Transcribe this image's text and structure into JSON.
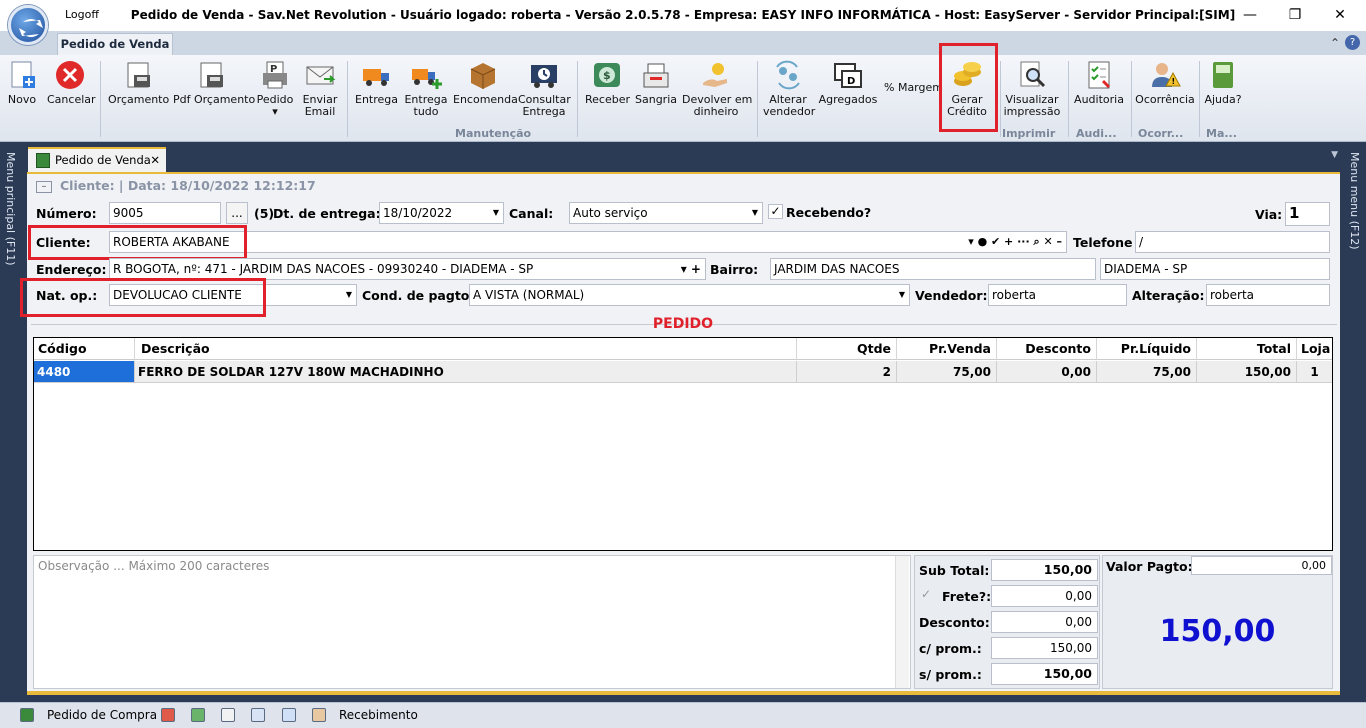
{
  "window": {
    "title": "Pedido de Venda - Sav.Net Revolution - Usuário logado: roberta - Versão 2.0.5.78 - Empresa: EASY INFO INFORMÁTICA - Host: EasyServer - Servidor Principal:[SIM]",
    "logoff": "Logoff",
    "minimize": "—",
    "restore": "❐",
    "close": "✕"
  },
  "ribbon": {
    "tab": "Pedido de Venda",
    "buttons": {
      "novo": "Novo",
      "cancelar": "Cancelar",
      "orcamento": "Orçamento",
      "pdf_orcamento": "Pdf Orçamento",
      "pedido": "Pedido",
      "enviar_email_1": "Enviar",
      "enviar_email_2": "Email",
      "entrega": "Entrega",
      "entrega_tudo_1": "Entrega",
      "entrega_tudo_2": "tudo",
      "encomenda": "Encomenda",
      "consultar_1": "Consultar",
      "consultar_2": "Entrega",
      "receber": "Receber",
      "sangria": "Sangria",
      "devolver_1": "Devolver em",
      "devolver_2": "dinheiro",
      "alterar_1": "Alterar",
      "alterar_2": "vendedor",
      "agregados": "Agregados",
      "margem": "% Margem",
      "gerar_1": "Gerar",
      "gerar_2": "Crédito",
      "visualizar_1": "Visualizar",
      "visualizar_2": "impressão",
      "auditoria": "Auditoria",
      "ocorrencia": "Ocorrência",
      "ajuda": "Ajuda?"
    },
    "groups": {
      "manutencao": "Manutenção",
      "imprimir": "Imprimir",
      "audi": "Audi...",
      "ocorr": "Ocorr...",
      "ma": "Ma..."
    }
  },
  "side": {
    "left": "Menu principal (F11)",
    "right": "Menu menu (F12)"
  },
  "doc_tab": {
    "label": "Pedido de Venda",
    "close": "✕"
  },
  "form": {
    "header_group": "Cliente:  | Data: 18/10/2022 12:12:17",
    "numero_label": "Número:",
    "numero_value": "9005",
    "numero_btn": "...",
    "num5": "(5)",
    "dt_entrega_label": "Dt. de entrega:",
    "dt_entrega_value": "18/10/2022",
    "canal_label": "Canal:",
    "canal_value": "Auto serviço",
    "recebendo_label": "Recebendo?",
    "via_label": "Via:",
    "via_value": "1",
    "cliente_label": "Cliente:",
    "cliente_value": "ROBERTA AKABANE",
    "cliente_tools": "▾ ● ✔ + ··· ⌕ ✕ –",
    "telefone_label": "Telefone",
    "telefone_value": " /",
    "endereco_label": "Endereço:",
    "endereco_value": "R BOGOTA, nº: 471 - JARDIM DAS NACOES - 09930240 - DIADEMA - SP",
    "endereco_tools": "▾ +",
    "bairro_label": "Bairro:",
    "bairro_value": "JARDIM DAS NACOES",
    "cidade_value": "DIADEMA - SP",
    "natop_label": "Nat. op.:",
    "natop_value": "DEVOLUCAO CLIENTE",
    "cond_label": "Cond. de pagto:",
    "cond_value": "A VISTA (NORMAL)",
    "vendedor_label": "Vendedor:",
    "vendedor_value": "roberta",
    "alteracao_label": "Alteração:",
    "alteracao_value": "roberta"
  },
  "pedido_title": "PEDIDO",
  "grid": {
    "headers": {
      "codigo": "Código",
      "descricao": "Descrição",
      "qtde": "Qtde",
      "prvenda": "Pr.Venda",
      "desconto": "Desconto",
      "prliquido": "Pr.Líquido",
      "total": "Total",
      "loja": "Loja"
    },
    "rows": [
      {
        "codigo": "4480",
        "descricao": "FERRO DE SOLDAR 127V 180W MACHADINHO",
        "qtde": "2",
        "prvenda": "75,00",
        "desconto": "0,00",
        "prliquido": "75,00",
        "total": "150,00",
        "loja": "1"
      }
    ]
  },
  "obs_placeholder": "Observação ... Máximo 200 caracteres",
  "totals": {
    "subtotal_label": "Sub Total:",
    "subtotal_value": "150,00",
    "frete_label": "Frete?:",
    "frete_value": "0,00",
    "desconto_label": "Desconto:",
    "desconto_value": "0,00",
    "cprom_label": "c/ prom.:",
    "cprom_value": "150,00",
    "sprom_label": "s/ prom.:",
    "sprom_value": "150,00",
    "valor_pagto_label": "Valor Pagto:",
    "valor_pagto_value": "0,00",
    "big_total": "150,00"
  },
  "statusbar": {
    "pedido_compra": "Pedido de Compra",
    "recebimento": "Recebimento"
  }
}
